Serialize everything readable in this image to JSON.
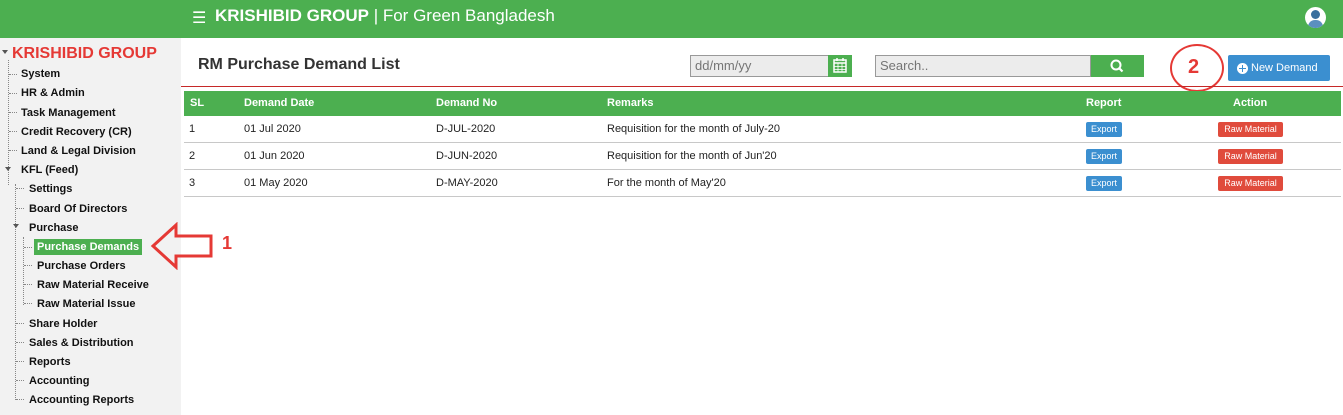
{
  "header": {
    "menu_icon": "hamburger-icon",
    "brand_bold": "KRISHIBID GROUP",
    "brand_tagline": "| For Green Bangladesh",
    "avatar_icon": "user-avatar-icon",
    "bar_color": "#4caf50"
  },
  "sidebar": {
    "title": "KRISHIBID GROUP",
    "items": [
      {
        "label": "System"
      },
      {
        "label": "HR & Admin"
      },
      {
        "label": "Task Management"
      },
      {
        "label": "Credit Recovery (CR)"
      },
      {
        "label": "Land & Legal Division"
      },
      {
        "label": "KFL (Feed)"
      },
      {
        "label": "Settings"
      },
      {
        "label": "Board Of Directors"
      },
      {
        "label": "Purchase"
      },
      {
        "label": "Purchase Demands"
      },
      {
        "label": "Purchase Orders"
      },
      {
        "label": "Raw Material Receive"
      },
      {
        "label": "Raw Material Issue"
      },
      {
        "label": "Share Holder"
      },
      {
        "label": "Sales & Distribution"
      },
      {
        "label": "Reports"
      },
      {
        "label": "Accounting"
      },
      {
        "label": "Accounting Reports"
      }
    ],
    "active_item": "Purchase Demands"
  },
  "annotations": {
    "marker1": "1",
    "marker2": "2"
  },
  "main": {
    "title": "RM Purchase Demand List",
    "date_placeholder": "dd/mm/yy",
    "search_placeholder": "Search..",
    "new_button_label": "New Demand",
    "table": {
      "columns": [
        "SL",
        "Demand Date",
        "Demand No",
        "Remarks",
        "Report",
        "Action"
      ],
      "rows": [
        {
          "sl": "1",
          "date": "01 Jul 2020",
          "no": "D-JUL-2020",
          "remarks": "Requisition for the month of July-20",
          "report": "Export",
          "action": "Raw Material"
        },
        {
          "sl": "2",
          "date": "01 Jun 2020",
          "no": "D-JUN-2020",
          "remarks": "Requisition for the month of Jun'20",
          "report": "Export",
          "action": "Raw Material"
        },
        {
          "sl": "3",
          "date": "01 May 2020",
          "no": "D-MAY-2020",
          "remarks": "For the month of May'20",
          "report": "Export",
          "action": "Raw Material"
        }
      ]
    }
  },
  "colors": {
    "accent_green": "#4caf50",
    "button_blue": "#3b8fd0",
    "button_red": "#e04b3c",
    "annotation_red": "#e53935"
  }
}
